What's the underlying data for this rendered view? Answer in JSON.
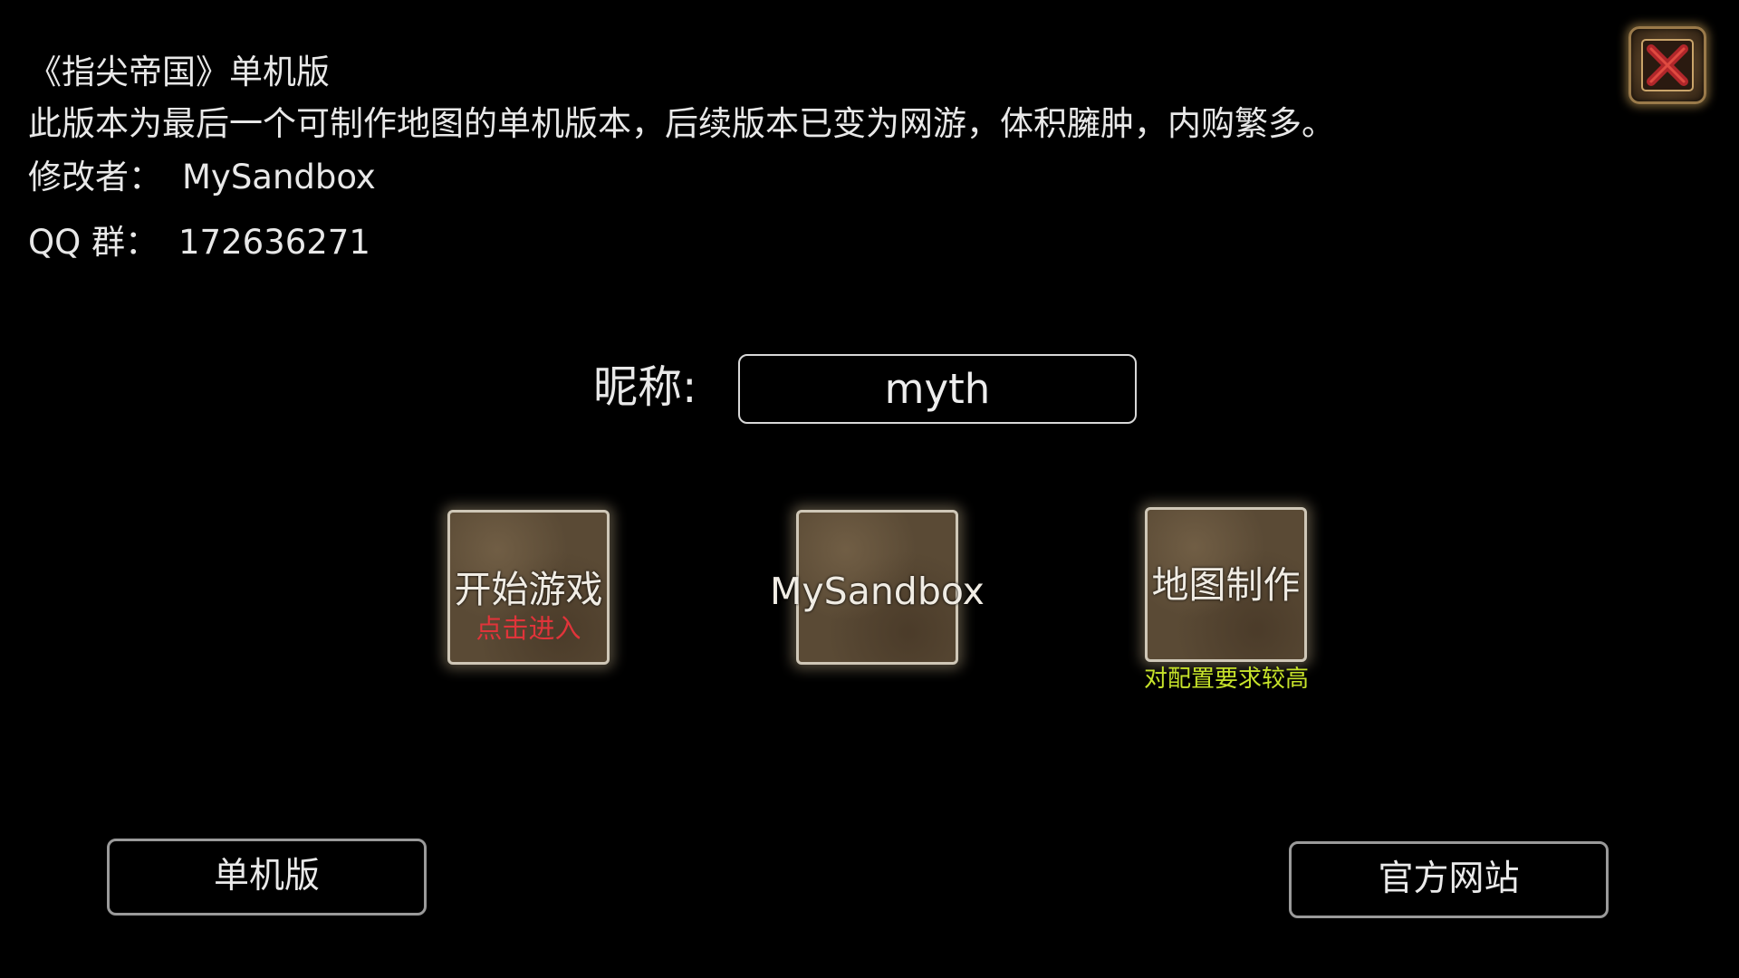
{
  "info": {
    "title": "《指尖帝国》单机版",
    "description": "此版本为最后一个可制作地图的单机版本，后续版本已变为网游，体积臃肿，内购繁多。",
    "modder_label": "修改者：",
    "modder_value": "MySandbox",
    "qq_label": "QQ 群：",
    "qq_value": "172636271"
  },
  "nickname": {
    "label": "昵称:",
    "value": "myth"
  },
  "tiles": {
    "start": {
      "label": "开始游戏",
      "sub": "点击进入"
    },
    "sandbox": {
      "label": "MySandbox"
    },
    "mapmaker": {
      "label": "地图制作",
      "note": "对配置要求较高"
    }
  },
  "buttons": {
    "offline": "单机版",
    "website": "官方网站"
  },
  "icons": {
    "close": "close-x-icon"
  },
  "colors": {
    "background": "#000000",
    "sub_label_red": "#e0343a",
    "note_green": "#c6e22a",
    "tile_brown": "#5a4a35",
    "close_red": "#b0262a"
  }
}
